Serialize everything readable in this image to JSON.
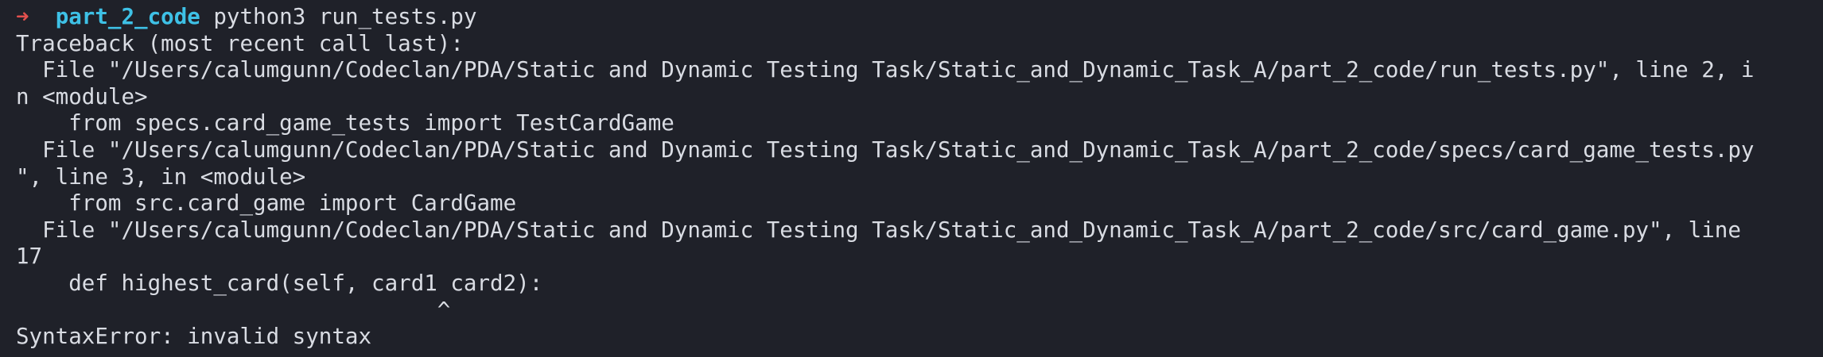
{
  "prompt": {
    "arrow": "➜",
    "directory": "part_2_code",
    "command": "python3 run_tests.py"
  },
  "output_lines": [
    "Traceback (most recent call last):",
    "  File \"/Users/calumgunn/Codeclan/PDA/Static and Dynamic Testing Task/Static_and_Dynamic_Task_A/part_2_code/run_tests.py\", line 2, i",
    "n <module>",
    "    from specs.card_game_tests import TestCardGame",
    "  File \"/Users/calumgunn/Codeclan/PDA/Static and Dynamic Testing Task/Static_and_Dynamic_Task_A/part_2_code/specs/card_game_tests.py",
    "\", line 3, in <module>",
    "    from src.card_game import CardGame",
    "  File \"/Users/calumgunn/Codeclan/PDA/Static and Dynamic Testing Task/Static_and_Dynamic_Task_A/part_2_code/src/card_game.py\", line",
    "17",
    "    def highest_card(self, card1 card2):",
    "                                ^",
    "SyntaxError: invalid syntax"
  ],
  "colors": {
    "background": "#1f2129",
    "text": "#d9dce3",
    "prompt_arrow": "#e2504d",
    "prompt_directory": "#3ec1e6"
  }
}
